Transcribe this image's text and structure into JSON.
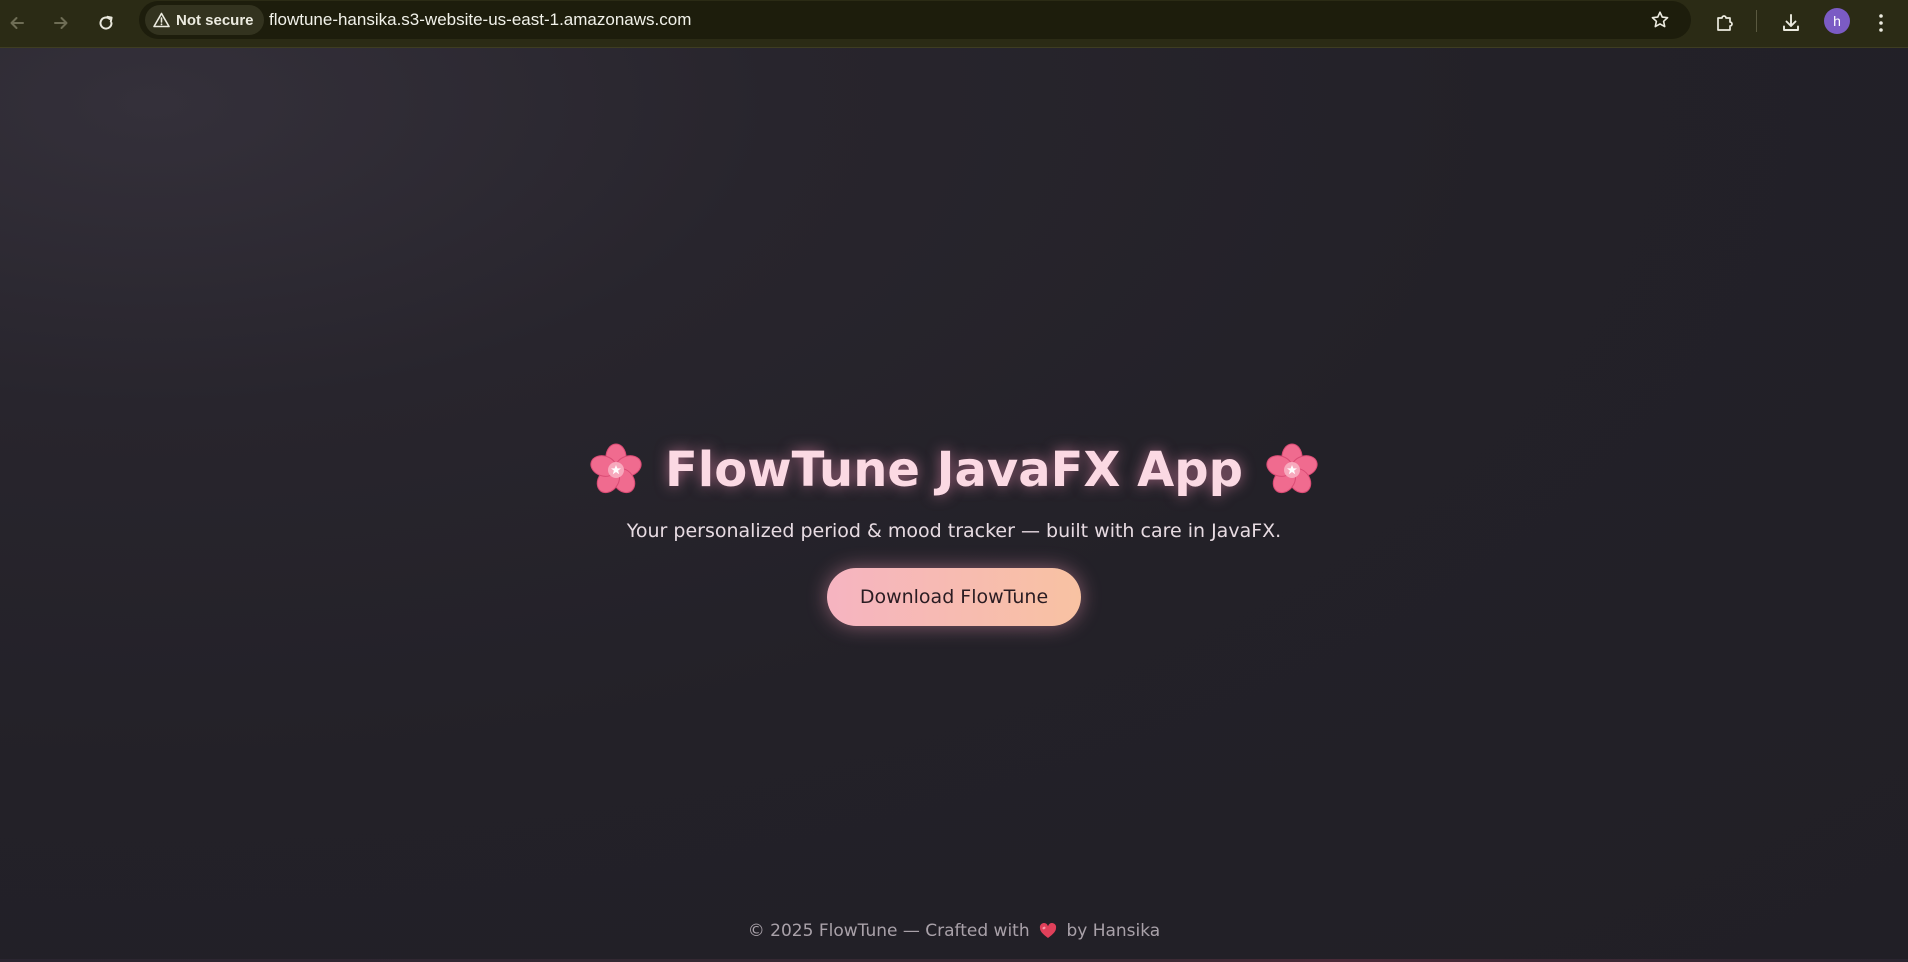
{
  "browser": {
    "security_label": "Not secure",
    "url": "flowtune-hansika.s3-website-us-east-1.amazonaws.com",
    "profile_initial": "h",
    "icons": {
      "back": "arrow-left-icon",
      "forward": "arrow-right-icon",
      "reload": "reload-icon",
      "warning": "warning-triangle-icon",
      "bookmark": "star-icon",
      "extensions": "puzzle-icon",
      "downloads": "download-icon",
      "menu": "kebab-menu-icon"
    },
    "colors": {
      "toolbar": "#2b2b15",
      "omnibox": "#1d1d0c",
      "avatar": "#7b5bc4"
    }
  },
  "hero": {
    "title": "FlowTune JavaFX App",
    "title_icon": "cherry-blossom-icon",
    "subtitle": "Your personalized period & mood tracker — built with care in JavaFX.",
    "button_label": "Download FlowTune"
  },
  "footer": {
    "text_before": "© 2025 FlowTune — Crafted with",
    "heart_icon": "heart-icon",
    "text_after": "by Hansika"
  },
  "colors": {
    "background": "#232128",
    "title": "#fbd9e3",
    "button_gradient_start": "#f6b4c1",
    "button_gradient_end": "#f8c2a2",
    "heart": "#e0405a"
  }
}
